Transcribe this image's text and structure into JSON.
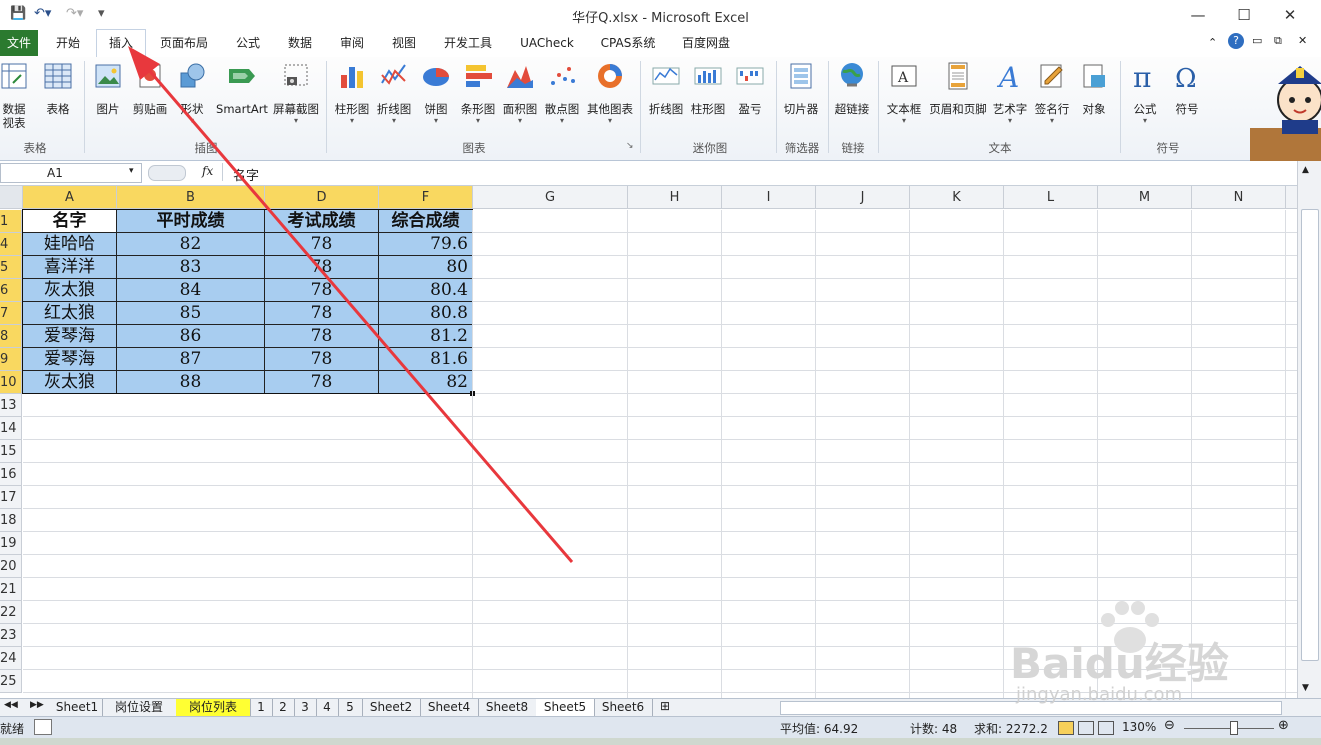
{
  "window": {
    "title": "华仔Q.xlsx - Microsoft Excel",
    "controls": {
      "minimize": "—",
      "maximize": "☐",
      "close": "✕"
    }
  },
  "tabs": [
    "文件",
    "开始",
    "插入",
    "页面布局",
    "公式",
    "数据",
    "审阅",
    "视图",
    "开发工具",
    "UACheck",
    "CPAS系统",
    "百度网盘"
  ],
  "active_tab": "插入",
  "ribbon": {
    "buttons": [
      {
        "label": "数据\n视表",
        "icon": "pivot-table-icon"
      },
      {
        "label": "表格",
        "icon": "table-icon"
      },
      {
        "label": "图片",
        "icon": "picture-icon"
      },
      {
        "label": "剪贴画",
        "icon": "clipart-icon"
      },
      {
        "label": "形状",
        "icon": "shapes-icon"
      },
      {
        "label": "SmartArt",
        "icon": "smartart-icon"
      },
      {
        "label": "屏幕截图",
        "icon": "screenshot-icon"
      },
      {
        "label": "柱形图",
        "icon": "column-chart-icon"
      },
      {
        "label": "折线图",
        "icon": "line-chart-icon"
      },
      {
        "label": "饼图",
        "icon": "pie-chart-icon"
      },
      {
        "label": "条形图",
        "icon": "bar-chart-icon"
      },
      {
        "label": "面积图",
        "icon": "area-chart-icon"
      },
      {
        "label": "散点图",
        "icon": "scatter-chart-icon"
      },
      {
        "label": "其他图表",
        "icon": "other-chart-icon"
      },
      {
        "label": "折线图",
        "icon": "sparkline-line-icon"
      },
      {
        "label": "柱形图",
        "icon": "sparkline-column-icon"
      },
      {
        "label": "盈亏",
        "icon": "sparkline-winloss-icon"
      },
      {
        "label": "切片器",
        "icon": "slicer-icon"
      },
      {
        "label": "超链接",
        "icon": "hyperlink-icon"
      },
      {
        "label": "文本框",
        "icon": "textbox-icon"
      },
      {
        "label": "页眉和页脚",
        "icon": "header-footer-icon"
      },
      {
        "label": "艺术字",
        "icon": "wordart-icon"
      },
      {
        "label": "签名行",
        "icon": "signature-icon"
      },
      {
        "label": "对象",
        "icon": "object-icon"
      },
      {
        "label": "公式",
        "icon": "equation-icon"
      },
      {
        "label": "符号",
        "icon": "symbol-icon"
      }
    ],
    "groups": [
      "表格",
      "插图",
      "图表",
      "迷你图",
      "筛选器",
      "链接",
      "文本",
      "符号"
    ]
  },
  "formula_bar": {
    "name_box": "A1",
    "fx": "fx",
    "content": "名字"
  },
  "columns": [
    "A",
    "B",
    "D",
    "F",
    "G",
    "H",
    "I",
    "J",
    "K",
    "L",
    "M",
    "N"
  ],
  "rows": [
    "1",
    "4",
    "5",
    "6",
    "7",
    "8",
    "9",
    "10",
    "13",
    "14",
    "15",
    "16",
    "17",
    "18",
    "19",
    "20",
    "21",
    "22",
    "23",
    "24",
    "25"
  ],
  "table": {
    "headers": [
      "名字",
      "平时成绩",
      "考试成绩",
      "综合成绩"
    ],
    "rows": [
      [
        "娃哈哈",
        "82",
        "78",
        "79.6"
      ],
      [
        "喜洋洋",
        "83",
        "78",
        "80"
      ],
      [
        "灰太狼",
        "84",
        "78",
        "80.4"
      ],
      [
        "红太狼",
        "85",
        "78",
        "80.8"
      ],
      [
        "爱琴海",
        "86",
        "78",
        "81.2"
      ],
      [
        "爱琴海",
        "87",
        "78",
        "81.6"
      ],
      [
        "灰太狼",
        "88",
        "78",
        "82"
      ]
    ]
  },
  "sheets": [
    "Sheet1",
    "岗位设置",
    "岗位列表",
    "1",
    "2",
    "3",
    "4",
    "5",
    "Sheet2",
    "Sheet4",
    "Sheet8",
    "Sheet5",
    "Sheet6"
  ],
  "active_sheet": "Sheet5",
  "status": {
    "mode": "就绪",
    "average": "平均值: 64.92",
    "count": "计数: 48",
    "sum": "求和: 2272.2",
    "zoom": "130%"
  },
  "watermark": {
    "brand": "Baidu经验",
    "url": "jingyan.baidu.com"
  },
  "colors": {
    "file_tab": "#2b7a2f",
    "selection_fill": "#a8cdf0",
    "header_highlight": "#f9d860",
    "arrow": "#e8383d"
  }
}
